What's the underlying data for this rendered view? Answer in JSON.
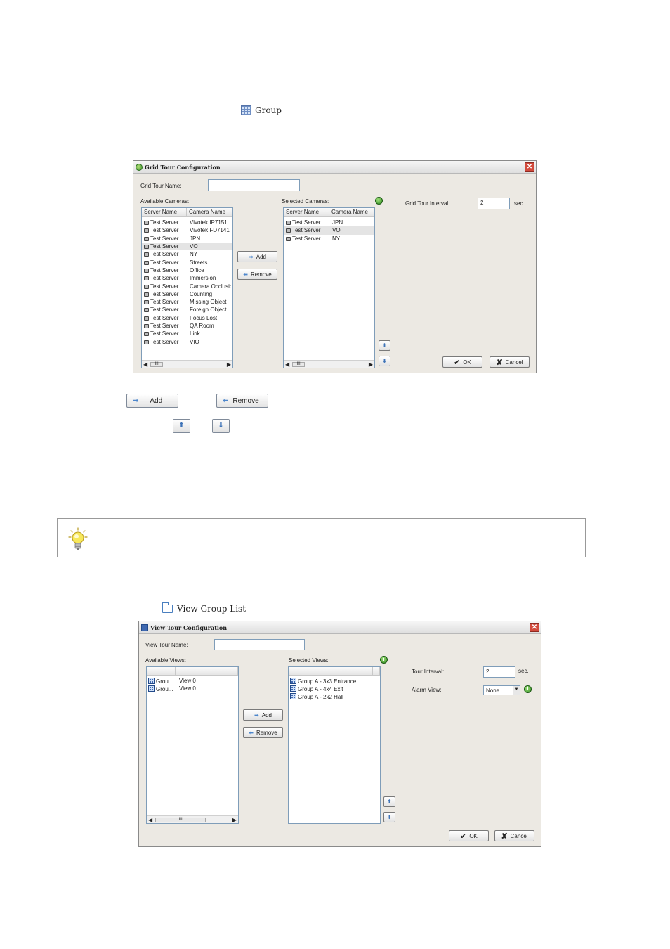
{
  "group_label": {
    "icon": "grid-icon",
    "text": "Group"
  },
  "grid_dialog": {
    "title": "Grid Tour Configuration",
    "name_label": "Grid Tour Name:",
    "name_value": "",
    "available_label": "Available Cameras:",
    "selected_label": "Selected Cameras:",
    "interval_label": "Grid Tour Interval:",
    "interval_value": "2",
    "interval_unit": "sec.",
    "columns": [
      "Server Name",
      "Camera Name"
    ],
    "available": [
      {
        "server": "Test Server",
        "camera": "Vivotek IP7151"
      },
      {
        "server": "Test Server",
        "camera": "Vivotek FD7141"
      },
      {
        "server": "Test Server",
        "camera": "JPN"
      },
      {
        "server": "Test Server",
        "camera": "VO"
      },
      {
        "server": "Test Server",
        "camera": "NY"
      },
      {
        "server": "Test Server",
        "camera": "Streets"
      },
      {
        "server": "Test Server",
        "camera": "Office"
      },
      {
        "server": "Test Server",
        "camera": "Immersion"
      },
      {
        "server": "Test Server",
        "camera": "Camera Occlusio"
      },
      {
        "server": "Test Server",
        "camera": "Counting"
      },
      {
        "server": "Test Server",
        "camera": "Missing Object"
      },
      {
        "server": "Test Server",
        "camera": "Foreign Object"
      },
      {
        "server": "Test Server",
        "camera": "Focus Lost"
      },
      {
        "server": "Test Server",
        "camera": "QA Room"
      },
      {
        "server": "Test Server",
        "camera": "Link"
      },
      {
        "server": "Test Server",
        "camera": "VIO"
      }
    ],
    "selected": [
      {
        "server": "Test Server",
        "camera": "JPN"
      },
      {
        "server": "Test Server",
        "camera": "VO"
      },
      {
        "server": "Test Server",
        "camera": "NY"
      }
    ],
    "add_label": "Add",
    "remove_label": "Remove",
    "ok_label": "OK",
    "cancel_label": "Cancel",
    "scroll_thumb": "III"
  },
  "standalone_buttons": {
    "add": "Add",
    "remove": "Remove"
  },
  "folder_label": {
    "icon": "folder-icon",
    "text": "View Group List"
  },
  "view_dialog": {
    "title": "View Tour Configuration",
    "name_label": "View Tour Name:",
    "name_value": "",
    "available_label": "Available Views:",
    "selected_label": "Selected Views:",
    "interval_label": "Tour Interval:",
    "interval_value": "2",
    "interval_unit": "sec.",
    "alarm_label": "Alarm View:",
    "alarm_value": "None",
    "available": [
      {
        "group": "Grou...",
        "view": "View 0"
      },
      {
        "group": "Grou...",
        "view": "View 0"
      }
    ],
    "selected": [
      "Group A - 3x3 Entrance",
      "Group A - 4x4 Exit",
      "Group A - 2x2 Hall"
    ],
    "add_label": "Add",
    "remove_label": "Remove",
    "ok_label": "OK",
    "cancel_label": "Cancel",
    "scroll_thumb": "III"
  }
}
